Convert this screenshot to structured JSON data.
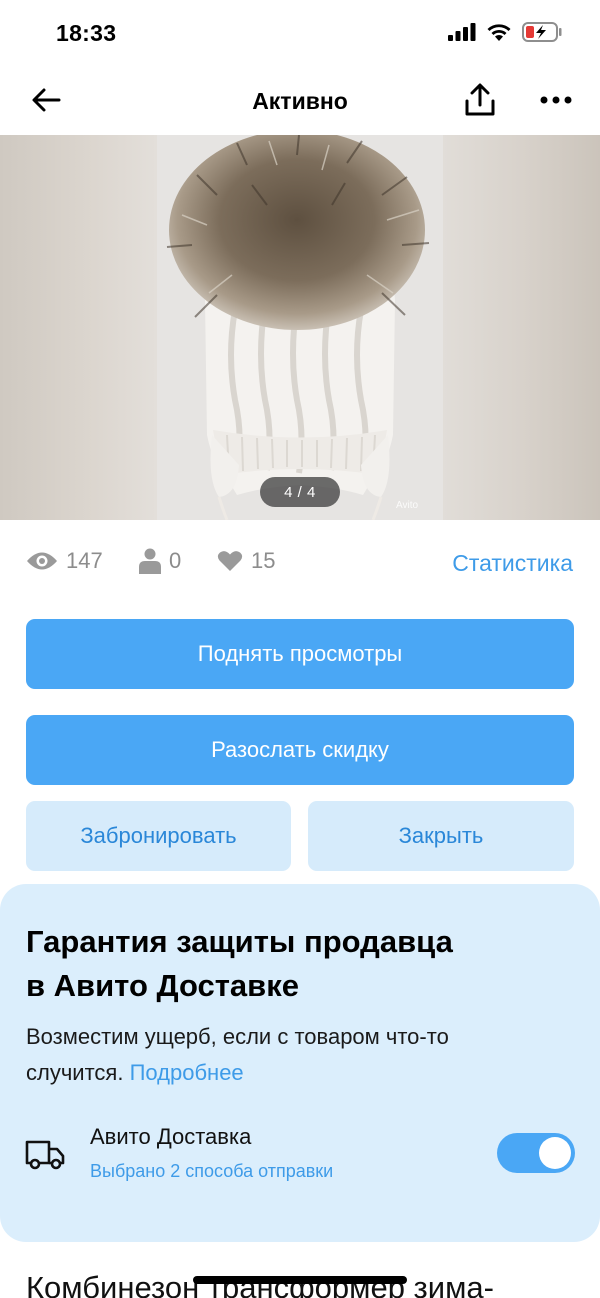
{
  "status_bar": {
    "time": "18:33"
  },
  "nav": {
    "title": "Активно"
  },
  "gallery": {
    "counter": "4 / 4",
    "watermark": "Avito"
  },
  "stats": {
    "views": "147",
    "contacts": "0",
    "favorites": "15",
    "link": "Статистика"
  },
  "actions": {
    "raise_views": "Поднять просмотры",
    "send_discount": "Разослать скидку",
    "reserve": "Забронировать",
    "close": "Закрыть"
  },
  "protection": {
    "title_line1": "Гарантия защиты продавца",
    "title_line2": "в Авито Доставке",
    "text": "Возместим ущерб, если с товаром что-то случится.",
    "link": "Подробнее",
    "delivery_title": "Авито Доставка",
    "delivery_subtitle": "Выбрано 2 способа отправки",
    "delivery_enabled": true
  },
  "listing": {
    "title": "Комбинезон трансформер зима-"
  },
  "colors": {
    "accent": "#4aa7f5",
    "accent_light": "#d6ebfb",
    "link": "#3e9be8",
    "panel": "#dbeefc"
  }
}
